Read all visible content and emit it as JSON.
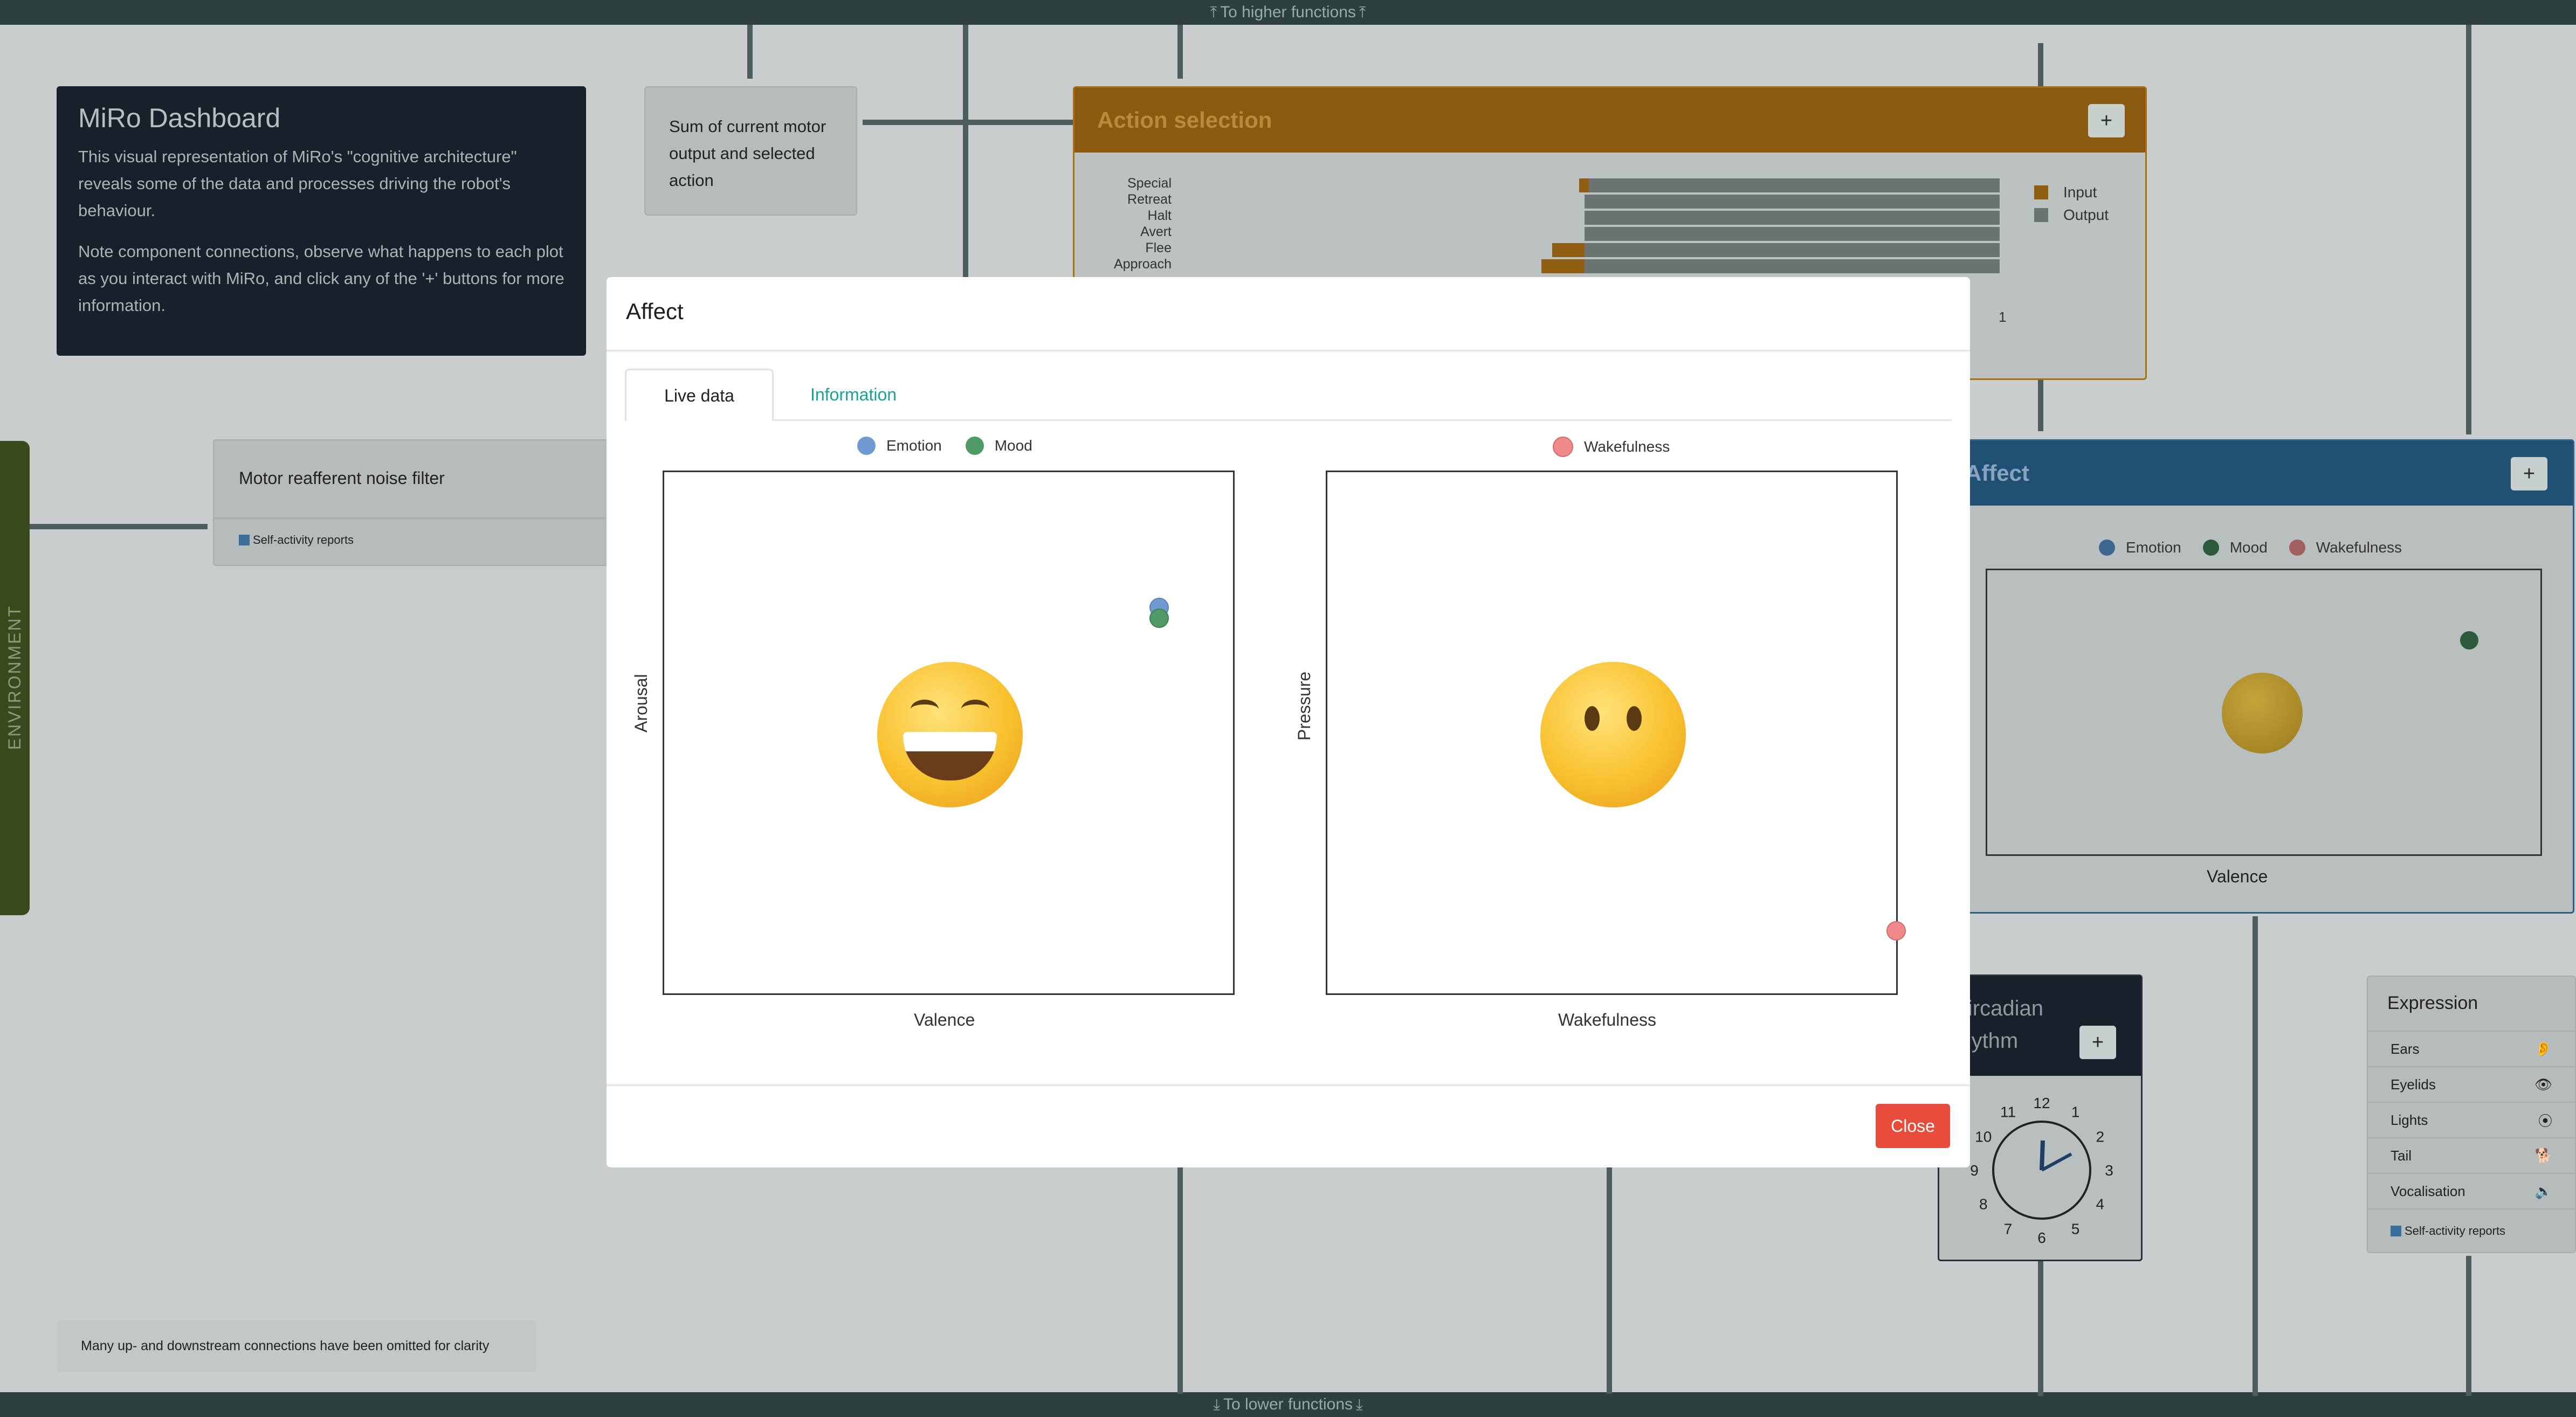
{
  "dashboard": {
    "top_bar": "To higher functions",
    "bottom_bar": "To lower functions",
    "environment_label": "ENVIRONMENT",
    "intro": {
      "title": "MiRo Dashboard",
      "para1": "This visual representation of MiRo's \"cognitive architecture\" reveals some of the data and processes driving the robot's behaviour.",
      "para2": "Note component connections, observe what happens to each plot as you interact with MiRo, and click any of the '+' buttons for more information."
    },
    "motor_sum": "Sum of current motor output and selected action",
    "action_selection": {
      "title": "Action selection",
      "plus": "+",
      "actions": [
        "Special",
        "Retreat",
        "Halt",
        "Avert",
        "Flee",
        "Approach"
      ],
      "legend": [
        "Input",
        "Output"
      ],
      "tick": "1"
    },
    "noise_filter": {
      "title": "Motor reafferent noise filter",
      "link": "Self-activity reports"
    },
    "affect_bg": {
      "title": "Affect",
      "plus": "+",
      "legend": [
        "Emotion",
        "Mood",
        "Wakefulness"
      ],
      "ylabel": "Arousal",
      "xlabel": "Valence"
    },
    "circadian": {
      "title_line1": "Circadian",
      "title_line2": "rhythm",
      "plus": "+",
      "numbers": [
        "12",
        "1",
        "2",
        "3",
        "4",
        "5",
        "6",
        "7",
        "8",
        "9",
        "10",
        "11"
      ]
    },
    "expression": {
      "title": "Expression",
      "items": [
        "Ears",
        "Eyelids",
        "Lights",
        "Tail",
        "Vocalisation"
      ],
      "link": "Self-activity reports"
    },
    "footnote": "Many up- and downstream connections have been omitted for clarity"
  },
  "modal": {
    "title": "Affect",
    "tabs": [
      "Live data",
      "Information"
    ],
    "close": "Close",
    "plot1": {
      "legend": [
        "Emotion",
        "Mood"
      ],
      "xlabel": "Valence",
      "ylabel": "Arousal",
      "face": "grinning-face-icon",
      "points": {
        "emotion": [
          0.87,
          0.74
        ],
        "mood": [
          0.87,
          0.72
        ]
      }
    },
    "plot2": {
      "legend": [
        "Wakefulness"
      ],
      "xlabel": "Wakefulness",
      "ylabel": "Pressure",
      "face": "neutral-face-icon",
      "points": {
        "wakefulness": [
          1.0,
          0.12
        ]
      }
    }
  },
  "colors": {
    "emotion": "#6f9bd1",
    "mood": "#4f9a66",
    "wakefulness": "#f08a8a",
    "accent_orange": "#e8920f",
    "accent_blue": "#2f7bbf",
    "close": "#e74c3c"
  }
}
